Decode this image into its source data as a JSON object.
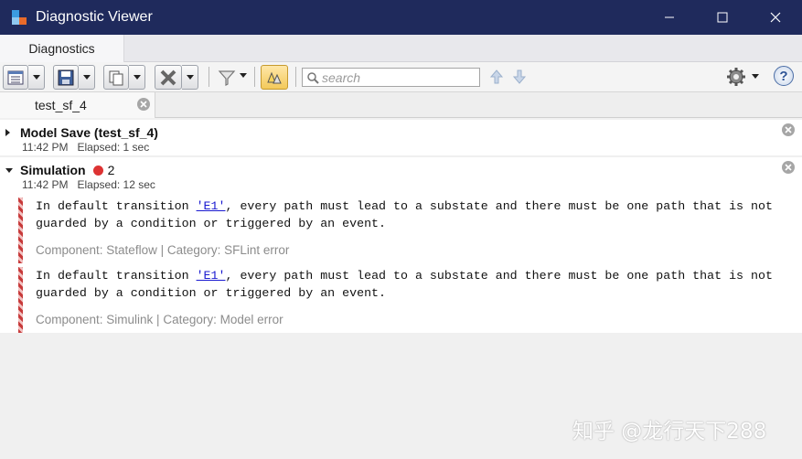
{
  "window": {
    "title": "Diagnostic Viewer"
  },
  "ribbon": {
    "tab_label": "Diagnostics"
  },
  "toolbar": {
    "search_placeholder": "search"
  },
  "doc_tabs": [
    {
      "label": "test_sf_4"
    }
  ],
  "groups": [
    {
      "title": "Model Save (test_sf_4)",
      "time": "11:42 PM",
      "elapsed": "Elapsed: 1 sec",
      "expanded": false
    },
    {
      "title": "Simulation",
      "error_count": "2",
      "time": "11:42 PM",
      "elapsed": "Elapsed: 12 sec",
      "expanded": true,
      "messages": [
        {
          "line1_pre": "In default transition ",
          "link": "'E1'",
          "line1_post": ", every path must lead to a substate and there must be one path that is not",
          "line2": "guarded by a condition or triggered by an event.",
          "meta": "Component:  Stateflow | Category:  SFLint error"
        },
        {
          "line1_pre": "In default transition ",
          "link": "'E1'",
          "line1_post": ", every path must lead to a substate and there must be one path that is not",
          "line2": "guarded by a condition or triggered by an event.",
          "meta": "Component:  Simulink | Category:  Model error"
        }
      ]
    }
  ],
  "watermark": "知乎 @龙行天下288",
  "colors": {
    "titlebar": "#1f2a5c",
    "error": "#d33333",
    "link": "#1a1ad0"
  }
}
